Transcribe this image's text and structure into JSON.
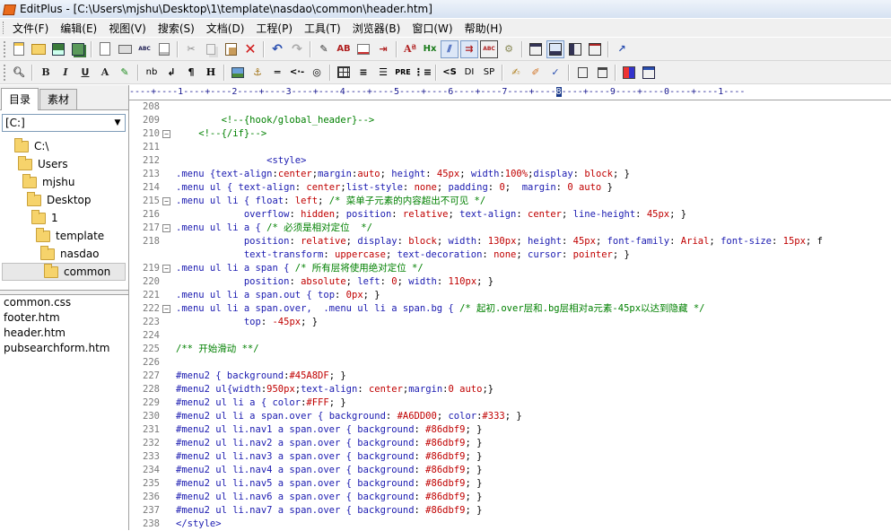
{
  "window": {
    "title": "EditPlus - [C:\\Users\\mjshu\\Desktop\\1\\template\\nasdao\\common\\header.htm]"
  },
  "menu": [
    "文件(F)",
    "编辑(E)",
    "视图(V)",
    "搜索(S)",
    "文档(D)",
    "工程(P)",
    "工具(T)",
    "浏览器(B)",
    "窗口(W)",
    "帮助(H)"
  ],
  "toolbar2_text": {
    "bold": "B",
    "italic": "I",
    "underline": "U",
    "font": "A",
    "nb": "nb",
    "para": "¶",
    "heading": "H",
    "pre": "PRE",
    "script": "<S",
    "div": "DI",
    "span": "SP",
    "hx": "Hx",
    "abc": "ABC"
  },
  "sidebar": {
    "tabs": [
      "目录",
      "素材"
    ],
    "drive": "[C:]",
    "tree": [
      "C:\\",
      "Users",
      "mjshu",
      "Desktop",
      "1",
      "template",
      "nasdao",
      "common"
    ],
    "files": [
      "common.css",
      "footer.htm",
      "header.htm",
      "pubsearchform.htm"
    ]
  },
  "ruler": {
    "text": "----+----1----+----2----+----3----+----4----+----5----+----6----+----7----+----",
    "cursor": "8",
    "rest": "----+----9----+----0----+----1----"
  },
  "code_lines": [
    {
      "n": "208",
      "fold": "",
      "segs": []
    },
    {
      "n": "209",
      "fold": "",
      "segs": [
        [
          "        <!--{hook/global_header}-->",
          "c-com"
        ]
      ]
    },
    {
      "n": "210",
      "fold": "⊟",
      "segs": [
        [
          "    <!--{/if}-->",
          "c-com"
        ]
      ]
    },
    {
      "n": "211",
      "fold": "",
      "segs": []
    },
    {
      "n": "212",
      "fold": "",
      "segs": [
        [
          "                <style>",
          "c-sel"
        ]
      ]
    },
    {
      "n": "213",
      "fold": "",
      "segs": [
        [
          ".menu {",
          "c-sel"
        ],
        [
          "text-align",
          "c-prop"
        ],
        [
          ":",
          "c-punc"
        ],
        [
          "center",
          "c-val"
        ],
        [
          ";",
          "c-punc"
        ],
        [
          "margin",
          "c-prop"
        ],
        [
          ":",
          "c-punc"
        ],
        [
          "auto",
          "c-val"
        ],
        [
          "; ",
          "c-punc"
        ],
        [
          "height",
          "c-prop"
        ],
        [
          ": ",
          "c-punc"
        ],
        [
          "45px",
          "c-val"
        ],
        [
          "; ",
          "c-punc"
        ],
        [
          "width",
          "c-prop"
        ],
        [
          ":",
          "c-punc"
        ],
        [
          "100%",
          "c-val"
        ],
        [
          ";",
          "c-punc"
        ],
        [
          "display",
          "c-prop"
        ],
        [
          ": ",
          "c-punc"
        ],
        [
          "block",
          "c-val"
        ],
        [
          "; }",
          "c-punc"
        ]
      ]
    },
    {
      "n": "214",
      "fold": "",
      "segs": [
        [
          ".menu ul { ",
          "c-sel"
        ],
        [
          "text-align",
          "c-prop"
        ],
        [
          ": ",
          "c-punc"
        ],
        [
          "center",
          "c-val"
        ],
        [
          ";",
          "c-punc"
        ],
        [
          "list-style",
          "c-prop"
        ],
        [
          ": ",
          "c-punc"
        ],
        [
          "none",
          "c-val"
        ],
        [
          "; ",
          "c-punc"
        ],
        [
          "padding",
          "c-prop"
        ],
        [
          ": ",
          "c-punc"
        ],
        [
          "0",
          "c-val"
        ],
        [
          ";  ",
          "c-punc"
        ],
        [
          "margin",
          "c-prop"
        ],
        [
          ": ",
          "c-punc"
        ],
        [
          "0 auto",
          "c-val"
        ],
        [
          " }",
          "c-punc"
        ]
      ]
    },
    {
      "n": "215",
      "fold": "⊟",
      "segs": [
        [
          ".menu ul li { ",
          "c-sel"
        ],
        [
          "float",
          "c-prop"
        ],
        [
          ": ",
          "c-punc"
        ],
        [
          "left",
          "c-val"
        ],
        [
          "; ",
          "c-punc"
        ],
        [
          "/* 菜单子元素的内容超出不可见 */",
          "c-com"
        ]
      ]
    },
    {
      "n": "216",
      "fold": "",
      "segs": [
        [
          "            ",
          "c-punc"
        ],
        [
          "overflow",
          "c-prop"
        ],
        [
          ": ",
          "c-punc"
        ],
        [
          "hidden",
          "c-val"
        ],
        [
          "; ",
          "c-punc"
        ],
        [
          "position",
          "c-prop"
        ],
        [
          ": ",
          "c-punc"
        ],
        [
          "relative",
          "c-val"
        ],
        [
          "; ",
          "c-punc"
        ],
        [
          "text-align",
          "c-prop"
        ],
        [
          ": ",
          "c-punc"
        ],
        [
          "center",
          "c-val"
        ],
        [
          "; ",
          "c-punc"
        ],
        [
          "line-height",
          "c-prop"
        ],
        [
          ": ",
          "c-punc"
        ],
        [
          "45px",
          "c-val"
        ],
        [
          "; }",
          "c-punc"
        ]
      ]
    },
    {
      "n": "217",
      "fold": "⊟",
      "segs": [
        [
          ".menu ul li a { ",
          "c-sel"
        ],
        [
          "/* 必须是相对定位  */",
          "c-com"
        ]
      ]
    },
    {
      "n": "218",
      "fold": "",
      "segs": [
        [
          "            ",
          "c-punc"
        ],
        [
          "position",
          "c-prop"
        ],
        [
          ": ",
          "c-punc"
        ],
        [
          "relative",
          "c-val"
        ],
        [
          "; ",
          "c-punc"
        ],
        [
          "display",
          "c-prop"
        ],
        [
          ": ",
          "c-punc"
        ],
        [
          "block",
          "c-val"
        ],
        [
          "; ",
          "c-punc"
        ],
        [
          "width",
          "c-prop"
        ],
        [
          ": ",
          "c-punc"
        ],
        [
          "130px",
          "c-val"
        ],
        [
          "; ",
          "c-punc"
        ],
        [
          "height",
          "c-prop"
        ],
        [
          ": ",
          "c-punc"
        ],
        [
          "45px",
          "c-val"
        ],
        [
          "; ",
          "c-punc"
        ],
        [
          "font-family",
          "c-prop"
        ],
        [
          ": ",
          "c-punc"
        ],
        [
          "Arial",
          "c-val"
        ],
        [
          "; ",
          "c-punc"
        ],
        [
          "font-size",
          "c-prop"
        ],
        [
          ": ",
          "c-punc"
        ],
        [
          "15px",
          "c-val"
        ],
        [
          "; f",
          "c-punc"
        ]
      ]
    },
    {
      "n": "",
      "fold": "",
      "segs": [
        [
          "            ",
          "c-punc"
        ],
        [
          "text-transform",
          "c-prop"
        ],
        [
          ": ",
          "c-punc"
        ],
        [
          "uppercase",
          "c-val"
        ],
        [
          "; ",
          "c-punc"
        ],
        [
          "text-decoration",
          "c-prop"
        ],
        [
          ": ",
          "c-punc"
        ],
        [
          "none",
          "c-val"
        ],
        [
          "; ",
          "c-punc"
        ],
        [
          "cursor",
          "c-prop"
        ],
        [
          ": ",
          "c-punc"
        ],
        [
          "pointer",
          "c-val"
        ],
        [
          "; }",
          "c-punc"
        ]
      ]
    },
    {
      "n": "219",
      "fold": "⊟",
      "segs": [
        [
          ".menu ul li a span { ",
          "c-sel"
        ],
        [
          "/* 所有层将使用绝对定位 */",
          "c-com"
        ]
      ]
    },
    {
      "n": "220",
      "fold": "",
      "segs": [
        [
          "            ",
          "c-punc"
        ],
        [
          "position",
          "c-prop"
        ],
        [
          ": ",
          "c-punc"
        ],
        [
          "absolute",
          "c-val"
        ],
        [
          "; ",
          "c-punc"
        ],
        [
          "left",
          "c-prop"
        ],
        [
          ": ",
          "c-punc"
        ],
        [
          "0",
          "c-val"
        ],
        [
          "; ",
          "c-punc"
        ],
        [
          "width",
          "c-prop"
        ],
        [
          ": ",
          "c-punc"
        ],
        [
          "110px",
          "c-val"
        ],
        [
          "; }",
          "c-punc"
        ]
      ]
    },
    {
      "n": "221",
      "fold": "",
      "segs": [
        [
          ".menu ul li a span.out { ",
          "c-sel"
        ],
        [
          "top",
          "c-prop"
        ],
        [
          ": ",
          "c-punc"
        ],
        [
          "0px",
          "c-val"
        ],
        [
          "; }",
          "c-punc"
        ]
      ]
    },
    {
      "n": "222",
      "fold": "⊟",
      "segs": [
        [
          ".menu ul li a span.over,  .menu ul li a span.bg { ",
          "c-sel"
        ],
        [
          "/* 起初.over层和.bg层相对a元素-45px以达到隐藏 */",
          "c-com"
        ]
      ]
    },
    {
      "n": "223",
      "fold": "",
      "segs": [
        [
          "            ",
          "c-punc"
        ],
        [
          "top",
          "c-prop"
        ],
        [
          ": ",
          "c-punc"
        ],
        [
          "-45px",
          "c-val"
        ],
        [
          "; }",
          "c-punc"
        ]
      ]
    },
    {
      "n": "224",
      "fold": "",
      "segs": []
    },
    {
      "n": "225",
      "fold": "",
      "segs": [
        [
          "/** 开始滑动 **/",
          "c-com"
        ]
      ]
    },
    {
      "n": "226",
      "fold": "",
      "segs": []
    },
    {
      "n": "227",
      "fold": "",
      "segs": [
        [
          "#menu2 { ",
          "c-sel"
        ],
        [
          "background",
          "c-prop"
        ],
        [
          ":",
          "c-punc"
        ],
        [
          "#45A8DF",
          "c-val"
        ],
        [
          "; }",
          "c-punc"
        ]
      ]
    },
    {
      "n": "228",
      "fold": "",
      "segs": [
        [
          "#menu2 ul{",
          "c-sel"
        ],
        [
          "width",
          "c-prop"
        ],
        [
          ":",
          "c-punc"
        ],
        [
          "950px",
          "c-val"
        ],
        [
          ";",
          "c-punc"
        ],
        [
          "text-align",
          "c-prop"
        ],
        [
          ": ",
          "c-punc"
        ],
        [
          "center",
          "c-val"
        ],
        [
          ";",
          "c-punc"
        ],
        [
          "margin",
          "c-prop"
        ],
        [
          ":",
          "c-punc"
        ],
        [
          "0 auto",
          "c-val"
        ],
        [
          ";}",
          "c-punc"
        ]
      ]
    },
    {
      "n": "229",
      "fold": "",
      "segs": [
        [
          "#menu2 ul li a { ",
          "c-sel"
        ],
        [
          "color",
          "c-prop"
        ],
        [
          ":",
          "c-punc"
        ],
        [
          "#FFF",
          "c-val"
        ],
        [
          "; }",
          "c-punc"
        ]
      ]
    },
    {
      "n": "230",
      "fold": "",
      "segs": [
        [
          "#menu2 ul li a span.over { ",
          "c-sel"
        ],
        [
          "background",
          "c-prop"
        ],
        [
          ": ",
          "c-punc"
        ],
        [
          "#A6DD00",
          "c-val"
        ],
        [
          "; ",
          "c-punc"
        ],
        [
          "color",
          "c-prop"
        ],
        [
          ":",
          "c-punc"
        ],
        [
          "#333",
          "c-val"
        ],
        [
          "; }",
          "c-punc"
        ]
      ]
    },
    {
      "n": "231",
      "fold": "",
      "segs": [
        [
          "#menu2 ul li.nav1 a span.over { ",
          "c-sel"
        ],
        [
          "background",
          "c-prop"
        ],
        [
          ": ",
          "c-punc"
        ],
        [
          "#86dbf9",
          "c-val"
        ],
        [
          "; }",
          "c-punc"
        ]
      ]
    },
    {
      "n": "232",
      "fold": "",
      "segs": [
        [
          "#menu2 ul li.nav2 a span.over { ",
          "c-sel"
        ],
        [
          "background",
          "c-prop"
        ],
        [
          ": ",
          "c-punc"
        ],
        [
          "#86dbf9",
          "c-val"
        ],
        [
          "; }",
          "c-punc"
        ]
      ]
    },
    {
      "n": "233",
      "fold": "",
      "segs": [
        [
          "#menu2 ul li.nav3 a span.over { ",
          "c-sel"
        ],
        [
          "background",
          "c-prop"
        ],
        [
          ": ",
          "c-punc"
        ],
        [
          "#86dbf9",
          "c-val"
        ],
        [
          "; }",
          "c-punc"
        ]
      ]
    },
    {
      "n": "234",
      "fold": "",
      "segs": [
        [
          "#menu2 ul li.nav4 a span.over { ",
          "c-sel"
        ],
        [
          "background",
          "c-prop"
        ],
        [
          ": ",
          "c-punc"
        ],
        [
          "#86dbf9",
          "c-val"
        ],
        [
          "; }",
          "c-punc"
        ]
      ]
    },
    {
      "n": "235",
      "fold": "",
      "segs": [
        [
          "#menu2 ul li.nav5 a span.over { ",
          "c-sel"
        ],
        [
          "background",
          "c-prop"
        ],
        [
          ": ",
          "c-punc"
        ],
        [
          "#86dbf9",
          "c-val"
        ],
        [
          "; }",
          "c-punc"
        ]
      ]
    },
    {
      "n": "236",
      "fold": "",
      "segs": [
        [
          "#menu2 ul li.nav6 a span.over { ",
          "c-sel"
        ],
        [
          "background",
          "c-prop"
        ],
        [
          ": ",
          "c-punc"
        ],
        [
          "#86dbf9",
          "c-val"
        ],
        [
          "; }",
          "c-punc"
        ]
      ]
    },
    {
      "n": "237",
      "fold": "",
      "segs": [
        [
          "#menu2 ul li.nav7 a span.over { ",
          "c-sel"
        ],
        [
          "background",
          "c-prop"
        ],
        [
          ": ",
          "c-punc"
        ],
        [
          "#86dbf9",
          "c-val"
        ],
        [
          "; }",
          "c-punc"
        ]
      ]
    },
    {
      "n": "238",
      "fold": "",
      "segs": [
        [
          "</style>",
          "c-sel"
        ]
      ]
    }
  ]
}
